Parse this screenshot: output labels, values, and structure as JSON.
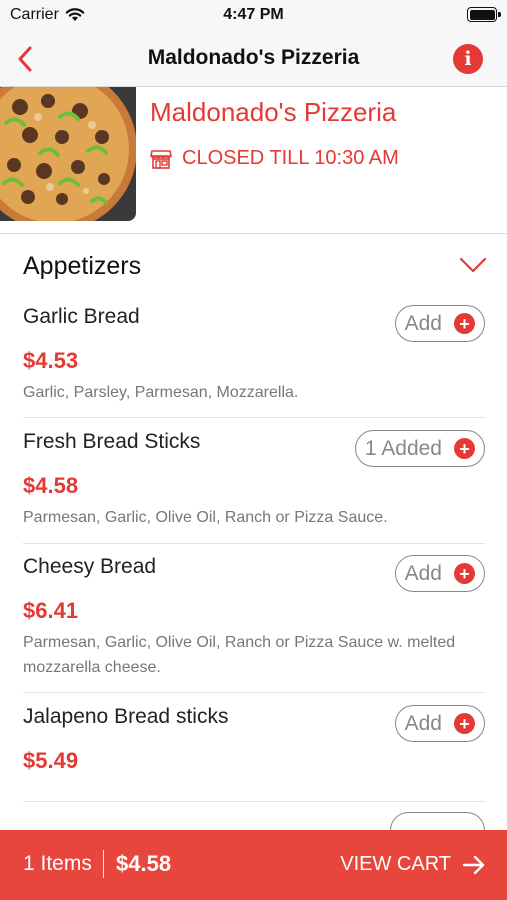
{
  "status_bar": {
    "carrier": "Carrier",
    "time": "4:47 PM"
  },
  "nav": {
    "title": "Maldonado's Pizzeria",
    "back_icon": "chevron-left-icon",
    "info_icon": "info-icon"
  },
  "restaurant": {
    "name": "Maldonado's Pizzeria",
    "status": "CLOSED TILL 10:30 AM",
    "status_icon": "store-icon"
  },
  "section": {
    "title": "Appetizers",
    "toggle_icon": "chevron-down-icon"
  },
  "items": [
    {
      "name": "Garlic Bread",
      "price": "$4.53",
      "desc": "Garlic, Parsley, Parmesan, Mozzarella.",
      "button_label": "Add"
    },
    {
      "name": "Fresh Bread Sticks",
      "price": "$4.58",
      "desc": "Parmesan, Garlic, Olive Oil, Ranch or Pizza Sauce.",
      "button_label": "1 Added"
    },
    {
      "name": "Cheesy Bread",
      "price": "$6.41",
      "desc": "Parmesan, Garlic, Olive Oil, Ranch or Pizza Sauce w. melted mozzarella cheese.",
      "button_label": "Add"
    },
    {
      "name": "Jalapeno Bread sticks",
      "price": "$5.49",
      "desc": "",
      "button_label": "Add"
    }
  ],
  "cart": {
    "count_label": "1 Items",
    "total": "$4.58",
    "view_label": "VIEW CART"
  },
  "colors": {
    "accent": "#e53935",
    "cart_bar": "#e8453c",
    "text": "#222222",
    "muted": "#777777"
  }
}
